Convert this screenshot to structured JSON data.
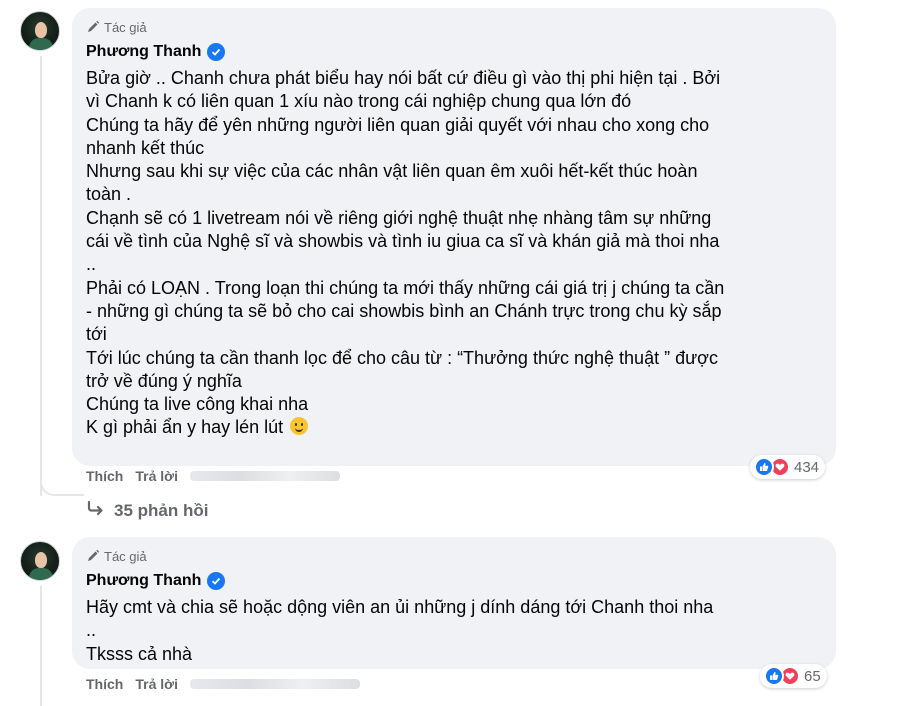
{
  "comments": [
    {
      "author_tag": "Tác giả",
      "author_name": "Phương Thanh",
      "lines": [
        "Bửa giờ .. Chanh chưa phát biểu hay nói bất cứ điều gì vào thị phi hiện tại . Bởi",
        "vì Chanh k có liên quan 1 xíu nào trong cái nghiệp chung qua lớn đó",
        "Chúng ta hãy để yên những người liên quan giải quyết với nhau cho xong cho",
        "nhanh kết thúc",
        "Nhưng sau khi sự việc của các nhân vật liên quan êm xuôi hết-kết thúc hoàn",
        "toàn .",
        "Chạnh sẽ có 1 livetream nói về riêng giới nghệ thuật nhẹ nhàng tâm sự những",
        "cái về tình của Nghệ sĩ và showbis và tình iu giua ca sĩ và khán giả mà thoi nha",
        "..",
        "Phải có LOẠN . Trong loạn thi chúng ta mới thấy những cái giá trị j chúng ta cần",
        "- những gì chúng ta sẽ bỏ cho cai showbis bình an Chánh trực trong chu kỳ sắp",
        "tới",
        "Tới lúc chúng ta cần thanh lọc để cho câu từ : “Thưởng thức nghệ thuật ” được",
        "trở về đúng ý nghĩa",
        "Chúng ta live công khai nha",
        "K gì phải ẩn y hay lén lút"
      ],
      "reaction_count": "434",
      "actions": {
        "like": "Thích",
        "reply": "Trả lời"
      }
    },
    {
      "author_tag": "Tác giả",
      "author_name": "Phương Thanh",
      "lines": [
        "Hãy cmt và chia sẽ hoặc dộng viên an ủi những j dính dáng tới Chanh thoi nha",
        "..",
        "Tksss cả nhà"
      ],
      "reaction_count": "65",
      "actions": {
        "like": "Thích",
        "reply": "Trả lời"
      }
    }
  ],
  "replies_label": "35 phản hồi",
  "icons": {
    "pen": "pen-icon",
    "verified": "verified-badge-icon",
    "like": "like-icon",
    "love": "heart-icon",
    "reply_arrow": "reply-arrow-icon",
    "emoji": "smile-emoji-icon"
  },
  "colors": {
    "bubble_bg": "#f0f2f5",
    "secondary_text": "#65676b",
    "verified_blue": "#1877f2",
    "love_red": "#f33e58"
  }
}
